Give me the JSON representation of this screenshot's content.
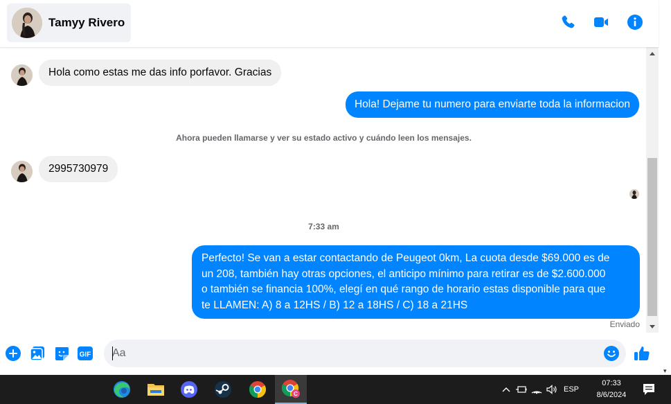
{
  "header": {
    "contact_name": "Tamyy Rivero",
    "actions": [
      "phone-call",
      "video-call",
      "conversation-info"
    ]
  },
  "messages": [
    {
      "direction": "in",
      "text": "Hola como estas me das info porfavor. Gracias"
    },
    {
      "direction": "out",
      "text": "Hola! Dejame tu numero para enviarte toda la informacion"
    },
    {
      "direction": "in",
      "text": "2995730979"
    },
    {
      "direction": "out",
      "lines": [
        "Perfecto!  Se van a estar contactando de Peugeot 0km, La cuota desde $69.000 es de",
        "un 208, también hay otras opciones, el anticipo mínimo para retirar es de $2.600.000",
        "o también se financia 100%, elegí en qué rango de horario estas disponible para que",
        "te LLAMEN: A) 8 a 12HS / B) 12 a 18HS / C) 18 a 21HS"
      ]
    }
  ],
  "chat": {
    "notice": "Ahora pueden llamarse y ver su estado activo y cuándo leen los mensajes.",
    "timestamp": "7:33 am",
    "status": "Enviado"
  },
  "composer": {
    "placeholder": "Aa",
    "gif_label": "GIF"
  },
  "taskbar": {
    "apps": [
      "edge",
      "file-explorer",
      "discord",
      "steam",
      "chrome",
      "chrome-profile"
    ],
    "active_app": "chrome-profile",
    "language": "ESP",
    "time": "07:33",
    "date": "8/6/2024"
  },
  "colors": {
    "accent": "#0084ff",
    "incoming_bubble": "#f0f0f0",
    "taskbar": "#1c1c1c"
  }
}
